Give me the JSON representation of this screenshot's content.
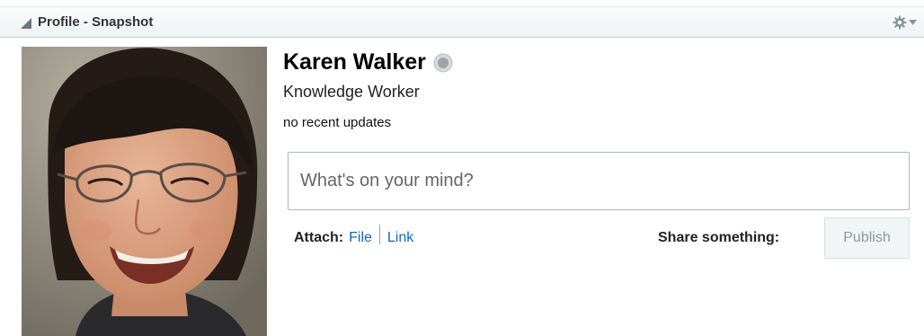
{
  "header": {
    "title": "Profile - Snapshot",
    "collapse_icon": "collapse-triangle-icon",
    "menu_icon": "gear-icon"
  },
  "profile": {
    "name": "Karen Walker",
    "presence_icon": "presence-status-icon",
    "job_title": "Knowledge Worker",
    "recent_updates": "no recent updates"
  },
  "composer": {
    "placeholder": "What's on your mind?",
    "attach_label": "Attach:",
    "attach_file": "File",
    "attach_link": "Link",
    "share_label": "Share something:",
    "publish_label": "Publish"
  },
  "colors": {
    "link": "#1566b7",
    "header_bg": "#eef2f5",
    "publish_disabled_text": "#8e979d"
  }
}
